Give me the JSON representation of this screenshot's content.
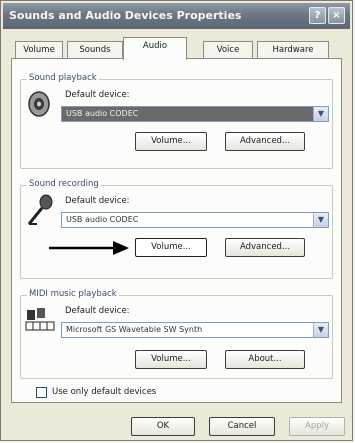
{
  "window": {
    "title": "Sounds and Audio Devices Properties"
  },
  "title_buttons": {
    "help": "?",
    "close": "×"
  },
  "tabs": [
    {
      "label": "Volume"
    },
    {
      "label": "Sounds"
    },
    {
      "label": "Audio"
    },
    {
      "label": "Voice"
    },
    {
      "label": "Hardware"
    }
  ],
  "playback": {
    "title": "Sound playback",
    "device_label": "Default device:",
    "device_value": "USB audio CODEC",
    "volume_button": "Volume...",
    "advanced_button": "Advanced..."
  },
  "recording": {
    "title": "Sound recording",
    "device_label": "Default device:",
    "device_value": "USB audio CODEC",
    "volume_button": "Volume...",
    "advanced_button": "Advanced..."
  },
  "midi": {
    "title": "MIDI music playback",
    "device_label": "Default device:",
    "device_value": "Microsoft GS Wavetable SW Synth",
    "volume_button": "Volume...",
    "about_button": "About..."
  },
  "use_default_devices": {
    "label": "Use only default devices",
    "checked": false
  },
  "footer": {
    "ok": "OK",
    "cancel": "Cancel",
    "apply": "Apply"
  }
}
